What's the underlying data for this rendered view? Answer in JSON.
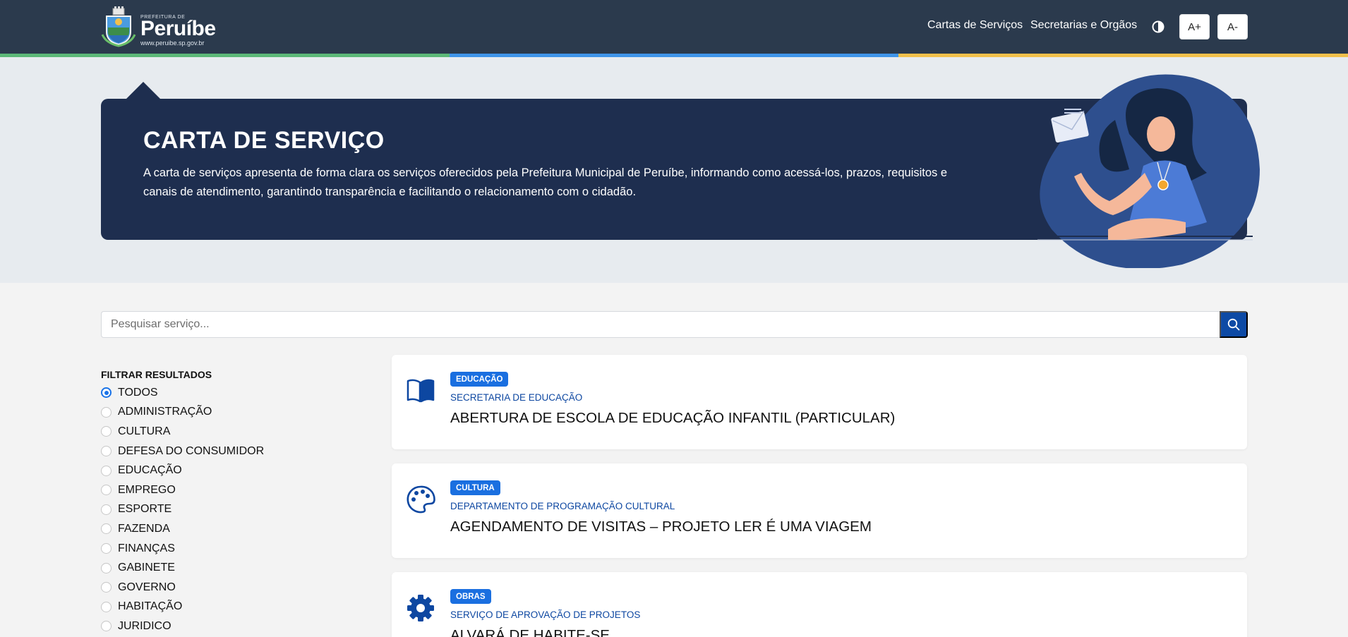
{
  "header": {
    "logo": {
      "small_text": "PREFEITURA DE",
      "name": "Peruíbe",
      "url": "www.peruibe.sp.gov.br"
    },
    "nav": [
      "Cartas de Serviços",
      "Secretarias e Orgãos"
    ],
    "font_increase": "A+",
    "font_decrease": "A-",
    "stripe_colors": [
      "#5cb878",
      "#3f94e8",
      "#f2c04b"
    ]
  },
  "banner": {
    "title": "CARTA DE SERVIÇO",
    "description": "A carta de serviços apresenta de forma clara os serviços oferecidos pela Prefeitura Municipal de Peruíbe, informando como acessá-los, prazos, requisitos e canais de atendimento, garantindo transparência e facilitando o relacionamento com o cidadão."
  },
  "search": {
    "placeholder": "Pesquisar serviço...",
    "value": ""
  },
  "filters": {
    "title": "FILTRAR RESULTADOS",
    "selected": "TODOS",
    "options": [
      "TODOS",
      "ADMINISTRAÇÃO",
      "CULTURA",
      "DEFESA DO CONSUMIDOR",
      "EDUCAÇÃO",
      "EMPREGO",
      "ESPORTE",
      "FAZENDA",
      "FINANÇAS",
      "GABINETE",
      "GOVERNO",
      "HABITAÇÃO",
      "JURIDICO"
    ]
  },
  "services": [
    {
      "icon": "book-icon",
      "category": "EDUCAÇÃO",
      "department": "SECRETARIA DE EDUCAÇÃO",
      "title": "ABERTURA DE ESCOLA DE EDUCAÇÃO INFANTIL (PARTICULAR)"
    },
    {
      "icon": "palette-icon",
      "category": "CULTURA",
      "department": "DEPARTAMENTO DE PROGRAMAÇÃO CULTURAL",
      "title": "AGENDAMENTO DE VISITAS – PROJETO LER É UMA VIAGEM"
    },
    {
      "icon": "gear-icon",
      "category": "OBRAS",
      "department": "SERVIÇO DE APROVAÇÃO DE PROJETOS",
      "title": "ALVARÁ DE HABITE-SE"
    }
  ],
  "colors": {
    "header": "#2b3a4d",
    "banner": "#1e2e4f",
    "accent": "#0d4aa5",
    "badge": "#1a6fe0"
  }
}
